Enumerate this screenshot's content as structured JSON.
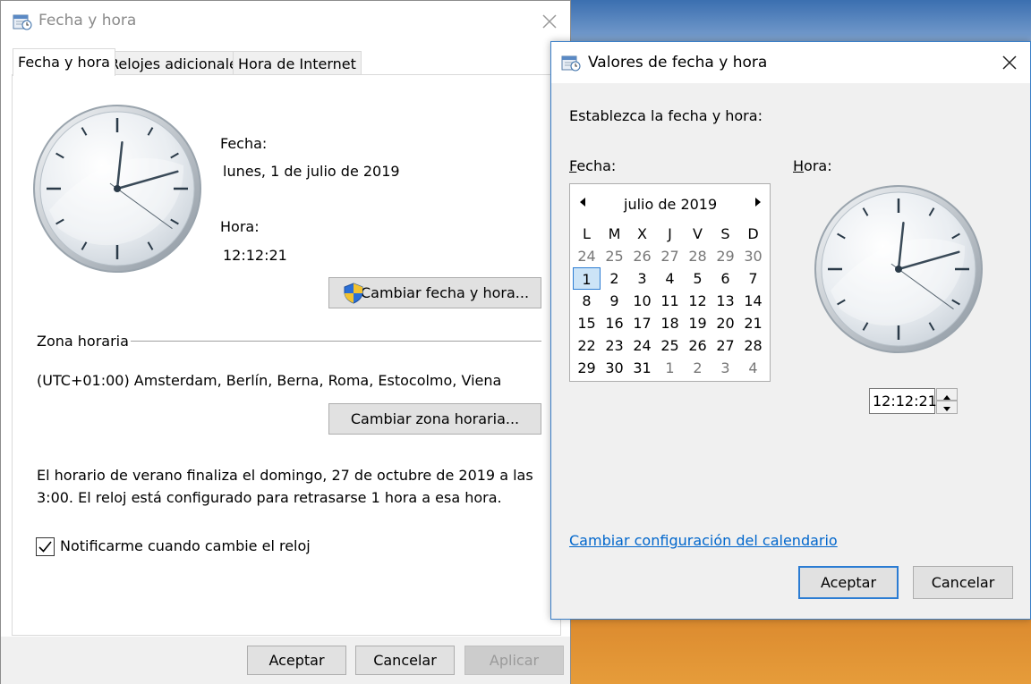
{
  "main_window": {
    "title": "Fecha y hora",
    "tabs": [
      "Fecha y hora",
      "Relojes adicionales",
      "Hora de Internet"
    ],
    "date_label": "Fecha:",
    "date_value": "lunes, 1 de julio de 2019",
    "time_label": "Hora:",
    "time_value": "12:12:21",
    "change_datetime_button": "Cambiar fecha y hora...",
    "timezone_section": "Zona horaria",
    "timezone_value": "(UTC+01:00) Amsterdam, Berlín, Berna, Roma, Estocolmo, Viena",
    "change_timezone_button": "Cambiar zona horaria...",
    "dst_line1": "El horario de verano finaliza el domingo, 27 de octubre de 2019 a las",
    "dst_line2": "3:00. El reloj está configurado para retrasarse 1 hora a esa hora.",
    "notify_checkbox_label": "Notificarme cuando cambie el reloj",
    "notify_checked": true,
    "ok_button": "Aceptar",
    "cancel_button": "Cancelar",
    "apply_button": "Aplicar"
  },
  "dialog": {
    "title": "Valores de fecha y hora",
    "instruction": "Establezca la fecha y hora:",
    "date_label_first": "F",
    "date_label_rest": "echa:",
    "time_label_first": "H",
    "time_label_rest": "ora:",
    "calendar": {
      "month_title": "julio de 2019",
      "weekdays": [
        "L",
        "M",
        "X",
        "J",
        "V",
        "S",
        "D"
      ],
      "weeks": [
        [
          "24",
          "25",
          "26",
          "27",
          "28",
          "29",
          "30"
        ],
        [
          "1",
          "2",
          "3",
          "4",
          "5",
          "6",
          "7"
        ],
        [
          "8",
          "9",
          "10",
          "11",
          "12",
          "13",
          "14"
        ],
        [
          "15",
          "16",
          "17",
          "18",
          "19",
          "20",
          "21"
        ],
        [
          "22",
          "23",
          "24",
          "25",
          "26",
          "27",
          "28"
        ],
        [
          "29",
          "30",
          "31",
          "1",
          "2",
          "3",
          "4"
        ]
      ],
      "selected_day": "1"
    },
    "time_value": "12:12:21",
    "calendar_settings_link": "Cambiar configuración del calendario",
    "ok_button": "Aceptar",
    "cancel_button": "Cancelar"
  },
  "clock_time": {
    "hours": 12,
    "minutes": 12,
    "seconds": 21
  },
  "icons": [
    "calendar-clock-icon",
    "close-icon",
    "shield-icon",
    "prev-month-icon",
    "next-month-icon",
    "spin-up-icon",
    "spin-down-icon",
    "checkmark-icon"
  ],
  "colors": {
    "accent": "#2b7cd3",
    "link": "#0066cc",
    "selected_day_bg": "#cce4f7"
  }
}
